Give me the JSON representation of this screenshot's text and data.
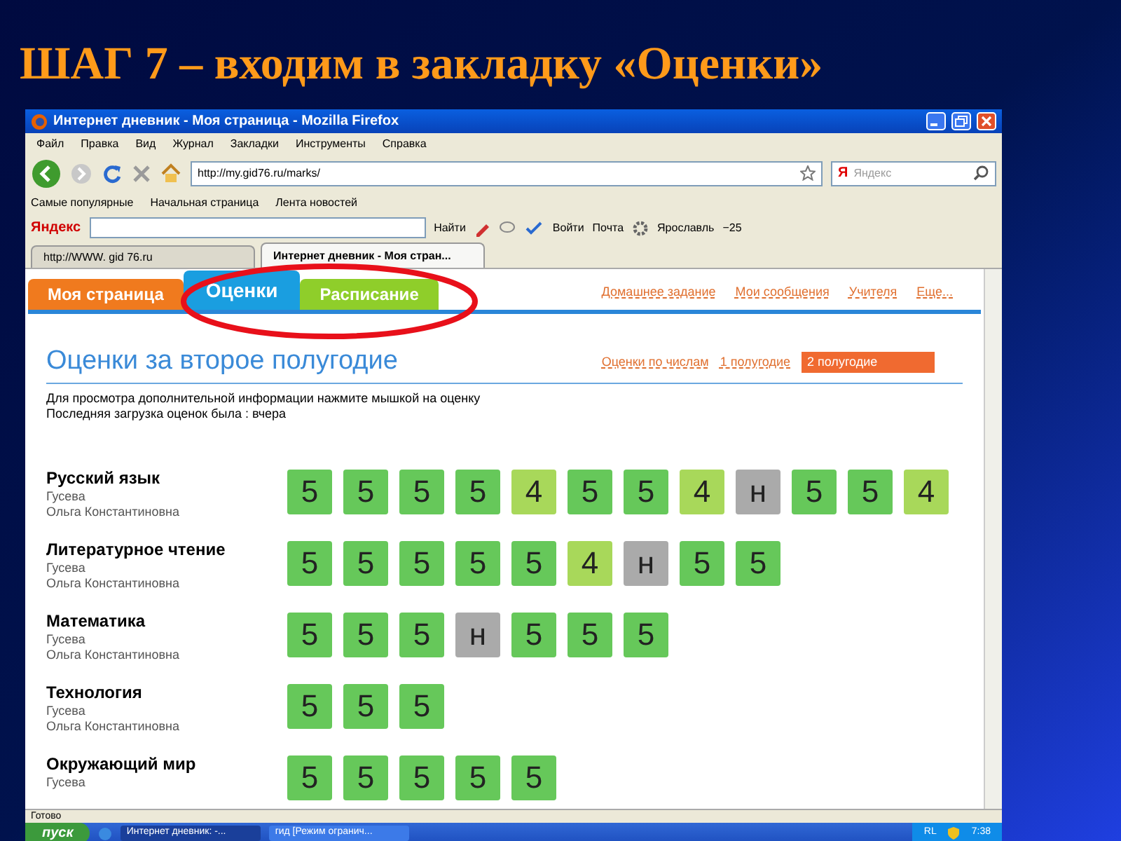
{
  "slide_title": "ШАГ 7 – входим в закладку «Оценки»",
  "browser": {
    "title": "Интернет дневник - Моя страница - Mozilla Firefox",
    "menu": [
      "Файл",
      "Правка",
      "Вид",
      "Журнал",
      "Закладки",
      "Инструменты",
      "Справка"
    ],
    "url": "http://my.gid76.ru/marks/",
    "search_placeholder": "Яндекс",
    "bookmarks": [
      "Самые популярные",
      "Начальная страница",
      "Лента новостей"
    ],
    "yandex_bar": {
      "logo": "Яндекс",
      "logo_letter": "Я",
      "find": "Найти",
      "login": "Войти",
      "mail": "Почта",
      "city": "Ярославль",
      "temperature": "−25"
    },
    "tabs": [
      {
        "label": "http://WWW. gid 76.ru",
        "selected": false
      },
      {
        "label": "Интернет дневник - Моя стран...",
        "selected": true
      }
    ]
  },
  "site": {
    "tabs": [
      {
        "label": "Моя страница",
        "color": "#f07a1e",
        "selected": false
      },
      {
        "label": "Оценки",
        "color": "#1a9ee0",
        "selected": true
      },
      {
        "label": "Расписание",
        "color": "#8fce2a",
        "selected": false
      }
    ],
    "links": [
      "Домашнее задание",
      "Мои сообщения",
      "Учителя",
      "Еще..."
    ],
    "heading": "Оценки за второе полугодие",
    "periods": [
      {
        "label": "Оценки по числам",
        "selected": false
      },
      {
        "label": "1 полугодие",
        "selected": false
      },
      {
        "label": "2 полугодие",
        "selected": true
      }
    ],
    "info": [
      "Для просмотра дополнительной информации нажмите мышкой на оценку",
      "Последняя загрузка оценок была : вчера"
    ],
    "subjects": [
      {
        "name": "Русский язык",
        "teacher": [
          "Гусева",
          "Ольга Константиновна"
        ],
        "marks": [
          {
            "value": "5",
            "color": "#66c85a"
          },
          {
            "value": "5",
            "color": "#66c85a"
          },
          {
            "value": "5",
            "color": "#66c85a"
          },
          {
            "value": "5",
            "color": "#66c85a"
          },
          {
            "value": "4",
            "color": "#a8d85a"
          },
          {
            "value": "5",
            "color": "#66c85a"
          },
          {
            "value": "5",
            "color": "#66c85a"
          },
          {
            "value": "4",
            "color": "#a8d85a"
          },
          {
            "value": "н",
            "color": "#aaaaaa"
          },
          {
            "value": "5",
            "color": "#66c85a"
          },
          {
            "value": "5",
            "color": "#66c85a"
          },
          {
            "value": "4",
            "color": "#a8d85a"
          }
        ]
      },
      {
        "name": "Литературное чтение",
        "teacher": [
          "Гусева",
          "Ольга Константиновна"
        ],
        "marks": [
          {
            "value": "5",
            "color": "#66c85a"
          },
          {
            "value": "5",
            "color": "#66c85a"
          },
          {
            "value": "5",
            "color": "#66c85a"
          },
          {
            "value": "5",
            "color": "#66c85a"
          },
          {
            "value": "5",
            "color": "#66c85a"
          },
          {
            "value": "4",
            "color": "#a8d85a"
          },
          {
            "value": "н",
            "color": "#aaaaaa"
          },
          {
            "value": "5",
            "color": "#66c85a"
          },
          {
            "value": "5",
            "color": "#66c85a"
          }
        ]
      },
      {
        "name": "Математика",
        "teacher": [
          "Гусева",
          "Ольга Константиновна"
        ],
        "marks": [
          {
            "value": "5",
            "color": "#66c85a"
          },
          {
            "value": "5",
            "color": "#66c85a"
          },
          {
            "value": "5",
            "color": "#66c85a"
          },
          {
            "value": "н",
            "color": "#aaaaaa"
          },
          {
            "value": "5",
            "color": "#66c85a"
          },
          {
            "value": "5",
            "color": "#66c85a"
          },
          {
            "value": "5",
            "color": "#66c85a"
          }
        ]
      },
      {
        "name": "Технология",
        "teacher": [
          "Гусева",
          "Ольга Константиновна"
        ],
        "marks": [
          {
            "value": "5",
            "color": "#66c85a"
          },
          {
            "value": "5",
            "color": "#66c85a"
          },
          {
            "value": "5",
            "color": "#66c85a"
          }
        ]
      },
      {
        "name": "Окружающий мир",
        "teacher": [
          "Гусева"
        ],
        "marks": [
          {
            "value": "5",
            "color": "#66c85a"
          },
          {
            "value": "5",
            "color": "#66c85a"
          },
          {
            "value": "5",
            "color": "#66c85a"
          },
          {
            "value": "5",
            "color": "#66c85a"
          },
          {
            "value": "5",
            "color": "#66c85a"
          }
        ]
      }
    ]
  },
  "status": "Готово",
  "taskbar": {
    "start": "пуск",
    "windows": [
      {
        "label": "Интернет дневник: -...",
        "selected": true
      },
      {
        "label": "гид [Режим огранич...",
        "selected": false
      }
    ],
    "lang": "RL",
    "clock": "7:38"
  }
}
